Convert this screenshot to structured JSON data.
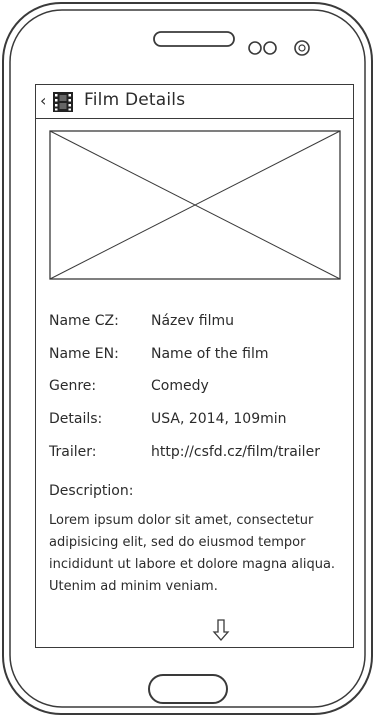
{
  "header": {
    "back_glyph": "‹",
    "title": "Film Details"
  },
  "fields": [
    {
      "label": "Name CZ:",
      "value": "Název filmu"
    },
    {
      "label": "Name EN:",
      "value": "Name of the film"
    },
    {
      "label": "Genre:",
      "value": "Comedy"
    },
    {
      "label": "Details:",
      "value": "USA, 2014, 109min"
    },
    {
      "label": "Trailer:",
      "value": "http://csfd.cz/film/trailer"
    }
  ],
  "description": {
    "label": "Description:",
    "text": "Lorem ipsum dolor sit amet, consectetur adipisicing elit, sed do eiusmod tempor incididunt ut labore et dolore magna aliqua. Utenim ad minim veniam."
  },
  "icons": {
    "film": "film-strip-icon",
    "scroll": "down-arrow-icon"
  }
}
